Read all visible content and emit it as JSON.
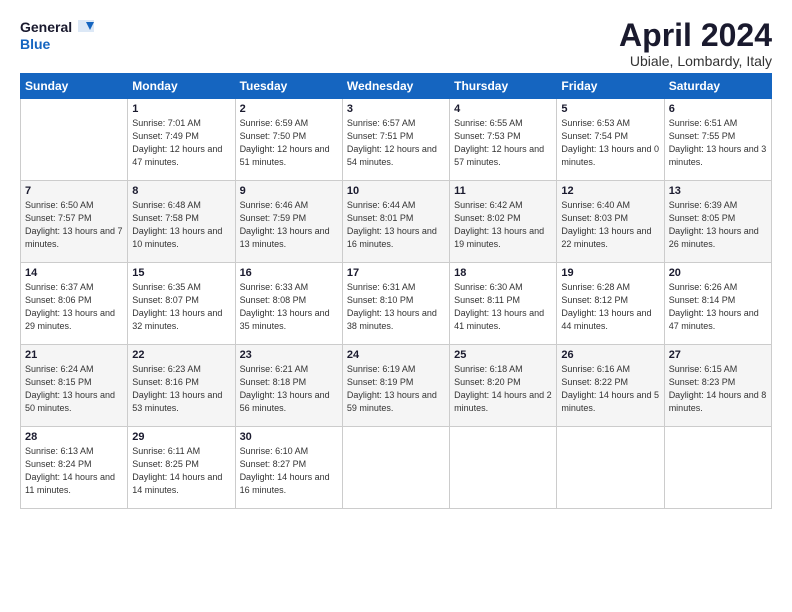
{
  "header": {
    "logo_line1": "General",
    "logo_line2": "Blue",
    "month_year": "April 2024",
    "location": "Ubiale, Lombardy, Italy"
  },
  "days_of_week": [
    "Sunday",
    "Monday",
    "Tuesday",
    "Wednesday",
    "Thursday",
    "Friday",
    "Saturday"
  ],
  "weeks": [
    [
      {
        "day": "",
        "sunrise": "",
        "sunset": "",
        "daylight": ""
      },
      {
        "day": "1",
        "sunrise": "Sunrise: 7:01 AM",
        "sunset": "Sunset: 7:49 PM",
        "daylight": "Daylight: 12 hours and 47 minutes."
      },
      {
        "day": "2",
        "sunrise": "Sunrise: 6:59 AM",
        "sunset": "Sunset: 7:50 PM",
        "daylight": "Daylight: 12 hours and 51 minutes."
      },
      {
        "day": "3",
        "sunrise": "Sunrise: 6:57 AM",
        "sunset": "Sunset: 7:51 PM",
        "daylight": "Daylight: 12 hours and 54 minutes."
      },
      {
        "day": "4",
        "sunrise": "Sunrise: 6:55 AM",
        "sunset": "Sunset: 7:53 PM",
        "daylight": "Daylight: 12 hours and 57 minutes."
      },
      {
        "day": "5",
        "sunrise": "Sunrise: 6:53 AM",
        "sunset": "Sunset: 7:54 PM",
        "daylight": "Daylight: 13 hours and 0 minutes."
      },
      {
        "day": "6",
        "sunrise": "Sunrise: 6:51 AM",
        "sunset": "Sunset: 7:55 PM",
        "daylight": "Daylight: 13 hours and 3 minutes."
      }
    ],
    [
      {
        "day": "7",
        "sunrise": "Sunrise: 6:50 AM",
        "sunset": "Sunset: 7:57 PM",
        "daylight": "Daylight: 13 hours and 7 minutes."
      },
      {
        "day": "8",
        "sunrise": "Sunrise: 6:48 AM",
        "sunset": "Sunset: 7:58 PM",
        "daylight": "Daylight: 13 hours and 10 minutes."
      },
      {
        "day": "9",
        "sunrise": "Sunrise: 6:46 AM",
        "sunset": "Sunset: 7:59 PM",
        "daylight": "Daylight: 13 hours and 13 minutes."
      },
      {
        "day": "10",
        "sunrise": "Sunrise: 6:44 AM",
        "sunset": "Sunset: 8:01 PM",
        "daylight": "Daylight: 13 hours and 16 minutes."
      },
      {
        "day": "11",
        "sunrise": "Sunrise: 6:42 AM",
        "sunset": "Sunset: 8:02 PM",
        "daylight": "Daylight: 13 hours and 19 minutes."
      },
      {
        "day": "12",
        "sunrise": "Sunrise: 6:40 AM",
        "sunset": "Sunset: 8:03 PM",
        "daylight": "Daylight: 13 hours and 22 minutes."
      },
      {
        "day": "13",
        "sunrise": "Sunrise: 6:39 AM",
        "sunset": "Sunset: 8:05 PM",
        "daylight": "Daylight: 13 hours and 26 minutes."
      }
    ],
    [
      {
        "day": "14",
        "sunrise": "Sunrise: 6:37 AM",
        "sunset": "Sunset: 8:06 PM",
        "daylight": "Daylight: 13 hours and 29 minutes."
      },
      {
        "day": "15",
        "sunrise": "Sunrise: 6:35 AM",
        "sunset": "Sunset: 8:07 PM",
        "daylight": "Daylight: 13 hours and 32 minutes."
      },
      {
        "day": "16",
        "sunrise": "Sunrise: 6:33 AM",
        "sunset": "Sunset: 8:08 PM",
        "daylight": "Daylight: 13 hours and 35 minutes."
      },
      {
        "day": "17",
        "sunrise": "Sunrise: 6:31 AM",
        "sunset": "Sunset: 8:10 PM",
        "daylight": "Daylight: 13 hours and 38 minutes."
      },
      {
        "day": "18",
        "sunrise": "Sunrise: 6:30 AM",
        "sunset": "Sunset: 8:11 PM",
        "daylight": "Daylight: 13 hours and 41 minutes."
      },
      {
        "day": "19",
        "sunrise": "Sunrise: 6:28 AM",
        "sunset": "Sunset: 8:12 PM",
        "daylight": "Daylight: 13 hours and 44 minutes."
      },
      {
        "day": "20",
        "sunrise": "Sunrise: 6:26 AM",
        "sunset": "Sunset: 8:14 PM",
        "daylight": "Daylight: 13 hours and 47 minutes."
      }
    ],
    [
      {
        "day": "21",
        "sunrise": "Sunrise: 6:24 AM",
        "sunset": "Sunset: 8:15 PM",
        "daylight": "Daylight: 13 hours and 50 minutes."
      },
      {
        "day": "22",
        "sunrise": "Sunrise: 6:23 AM",
        "sunset": "Sunset: 8:16 PM",
        "daylight": "Daylight: 13 hours and 53 minutes."
      },
      {
        "day": "23",
        "sunrise": "Sunrise: 6:21 AM",
        "sunset": "Sunset: 8:18 PM",
        "daylight": "Daylight: 13 hours and 56 minutes."
      },
      {
        "day": "24",
        "sunrise": "Sunrise: 6:19 AM",
        "sunset": "Sunset: 8:19 PM",
        "daylight": "Daylight: 13 hours and 59 minutes."
      },
      {
        "day": "25",
        "sunrise": "Sunrise: 6:18 AM",
        "sunset": "Sunset: 8:20 PM",
        "daylight": "Daylight: 14 hours and 2 minutes."
      },
      {
        "day": "26",
        "sunrise": "Sunrise: 6:16 AM",
        "sunset": "Sunset: 8:22 PM",
        "daylight": "Daylight: 14 hours and 5 minutes."
      },
      {
        "day": "27",
        "sunrise": "Sunrise: 6:15 AM",
        "sunset": "Sunset: 8:23 PM",
        "daylight": "Daylight: 14 hours and 8 minutes."
      }
    ],
    [
      {
        "day": "28",
        "sunrise": "Sunrise: 6:13 AM",
        "sunset": "Sunset: 8:24 PM",
        "daylight": "Daylight: 14 hours and 11 minutes."
      },
      {
        "day": "29",
        "sunrise": "Sunrise: 6:11 AM",
        "sunset": "Sunset: 8:25 PM",
        "daylight": "Daylight: 14 hours and 14 minutes."
      },
      {
        "day": "30",
        "sunrise": "Sunrise: 6:10 AM",
        "sunset": "Sunset: 8:27 PM",
        "daylight": "Daylight: 14 hours and 16 minutes."
      },
      {
        "day": "",
        "sunrise": "",
        "sunset": "",
        "daylight": ""
      },
      {
        "day": "",
        "sunrise": "",
        "sunset": "",
        "daylight": ""
      },
      {
        "day": "",
        "sunrise": "",
        "sunset": "",
        "daylight": ""
      },
      {
        "day": "",
        "sunrise": "",
        "sunset": "",
        "daylight": ""
      }
    ]
  ]
}
